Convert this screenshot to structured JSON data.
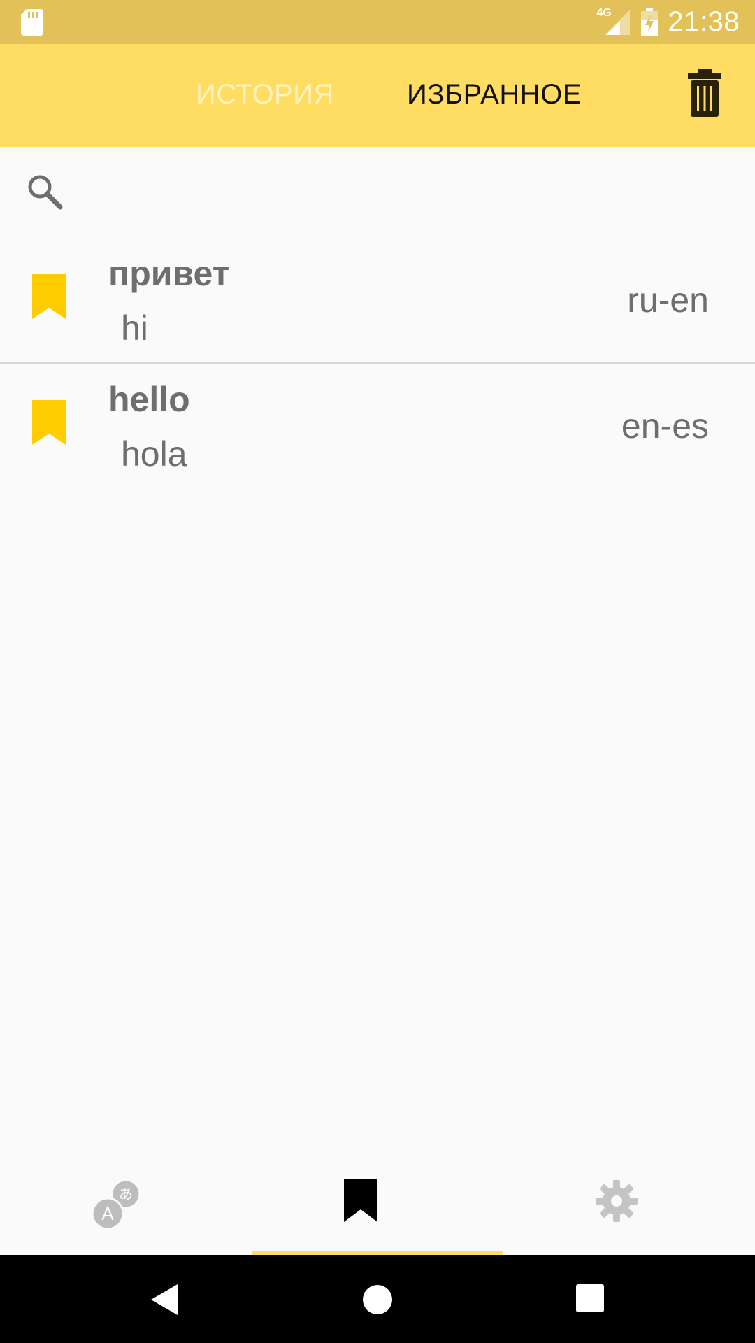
{
  "status_bar": {
    "network": "4G",
    "time": "21:38"
  },
  "toolbar": {
    "tabs": [
      {
        "label": "ИСТОРИЯ",
        "active": false
      },
      {
        "label": "ИЗБРАННОЕ",
        "active": true
      }
    ],
    "trash_icon": "trash-icon"
  },
  "search": {
    "placeholder": "",
    "value": "",
    "icon": "search-icon"
  },
  "favorites": [
    {
      "source": "привет",
      "translation": "hi",
      "lang": "ru-en",
      "bookmarked": true
    },
    {
      "source": "hello",
      "translation": "hola",
      "lang": "en-es",
      "bookmarked": true
    }
  ],
  "bottom_nav": {
    "items": [
      {
        "icon": "translate-icon",
        "active": false
      },
      {
        "icon": "bookmark-icon",
        "active": true
      },
      {
        "icon": "gear-icon",
        "active": false
      }
    ]
  },
  "colors": {
    "status_bar": "#e1c158",
    "toolbar": "#ffdc62",
    "bookmark": "#ffcc00",
    "text_gray": "#6e6e6e",
    "inactive_tab": "#fff3c4"
  }
}
